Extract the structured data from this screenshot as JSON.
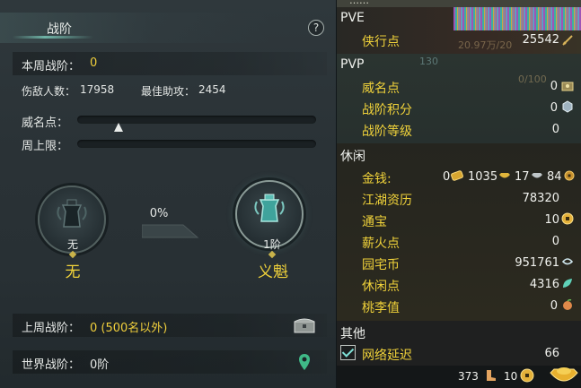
{
  "left": {
    "title": "战阶",
    "help_label": "?",
    "weekly_label": "本周战阶：",
    "weekly_value": "0",
    "defeated_label": "伤敌人数：",
    "defeated_value": "17958",
    "assist_label": "最佳助攻：",
    "assist_value": "2454",
    "prestige_label": "威名点：",
    "prestige_progress": 0.1,
    "weekly_cap_label": "周上限：",
    "weekly_cap_progress": 0,
    "current_rank_level": "无",
    "current_rank_name": "无",
    "progress_percent": "0%",
    "next_rank_level": "1阶",
    "next_rank_name": "义魁",
    "last_week_label": "上周战阶：",
    "last_week_value": "0 (500名以外)",
    "world_label": "世界战阶：",
    "world_value": "0阶"
  },
  "right": {
    "top_partial": "……",
    "pve_title": "PVE",
    "xiaxing_label": "侠行点",
    "xiaxing_value": "25542",
    "faded_text_1": "20.97万/20",
    "faded_text_2": "130",
    "faded_text_3": "0/100",
    "pvp_title": "PVP",
    "weiming_label": "威名点",
    "weiming_value": "0",
    "zhanjie_score_label": "战阶积分",
    "zhanjie_score_value": "0",
    "zhanjie_level_label": "战阶等级",
    "zhanjie_level_value": "0",
    "leisure_title": "休闲",
    "money_label": "金钱:",
    "money_gold": "0",
    "money_silver": "1035",
    "money_copper": "17",
    "money_extra": "84",
    "jianghu_label": "江湖资历",
    "jianghu_value": "78320",
    "tongbao_label": "通宝",
    "tongbao_value": "10",
    "xinhuo_label": "薪火点",
    "xinhuo_value": "0",
    "yuanzhai_label": "园宅币",
    "yuanzhai_value": "951761",
    "xiuxian_label": "休闲点",
    "xiuxian_value": "4316",
    "taoli_label": "桃李值",
    "taoli_value": "0",
    "other_title": "其他",
    "latency_label": "网络延迟",
    "latency_value": "66",
    "bottom_value_1": "373",
    "bottom_value_2": "10"
  },
  "colors": {
    "accent_gold": "#f0d23a",
    "label_text": "#e5e8e6",
    "panel_bg": "#2a3236"
  }
}
